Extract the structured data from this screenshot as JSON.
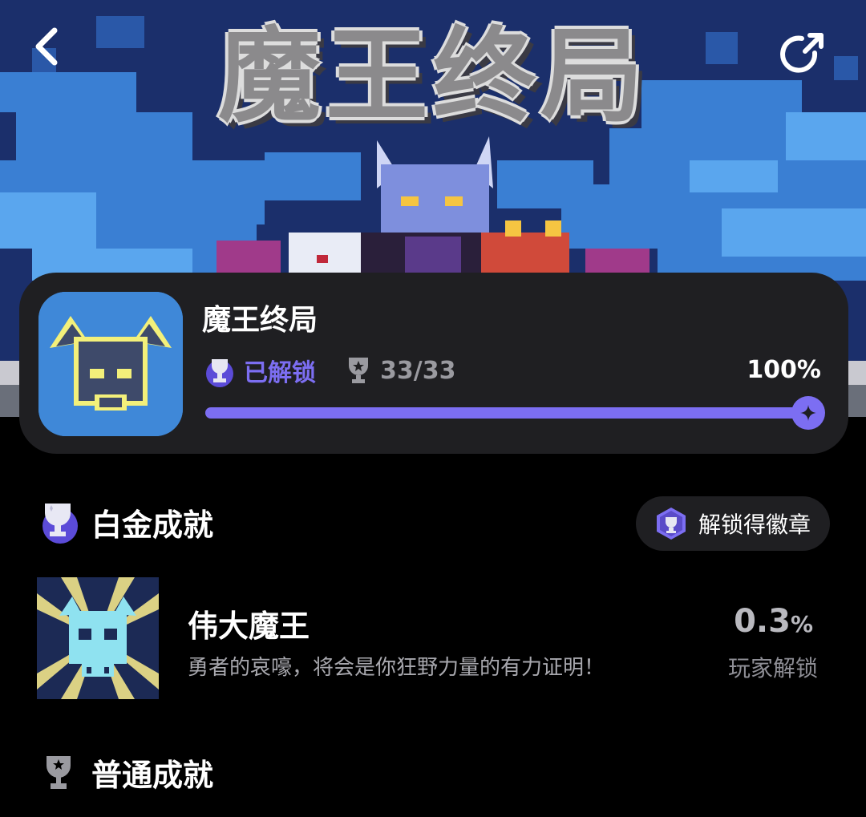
{
  "banner": {
    "title": "魔王终局",
    "back_icon": "chevron-left-icon",
    "share_icon": "share-icon"
  },
  "game": {
    "name": "魔王终局",
    "status_label": "已解锁",
    "achievement_count": "33/33",
    "progress_percent_label": "100%",
    "progress": 1.0,
    "accent_color": "#7c6ef2"
  },
  "platinum": {
    "section_title": "白金成就",
    "badge_button_label": "解锁得徽章",
    "achievement": {
      "name": "伟大魔王",
      "description": "勇者的哀嚎，将会是你狂野力量的有力证明！",
      "rate_value": "0.3",
      "rate_unit": "%",
      "rate_label": "玩家解锁"
    }
  },
  "normal": {
    "section_title": "普通成就"
  }
}
